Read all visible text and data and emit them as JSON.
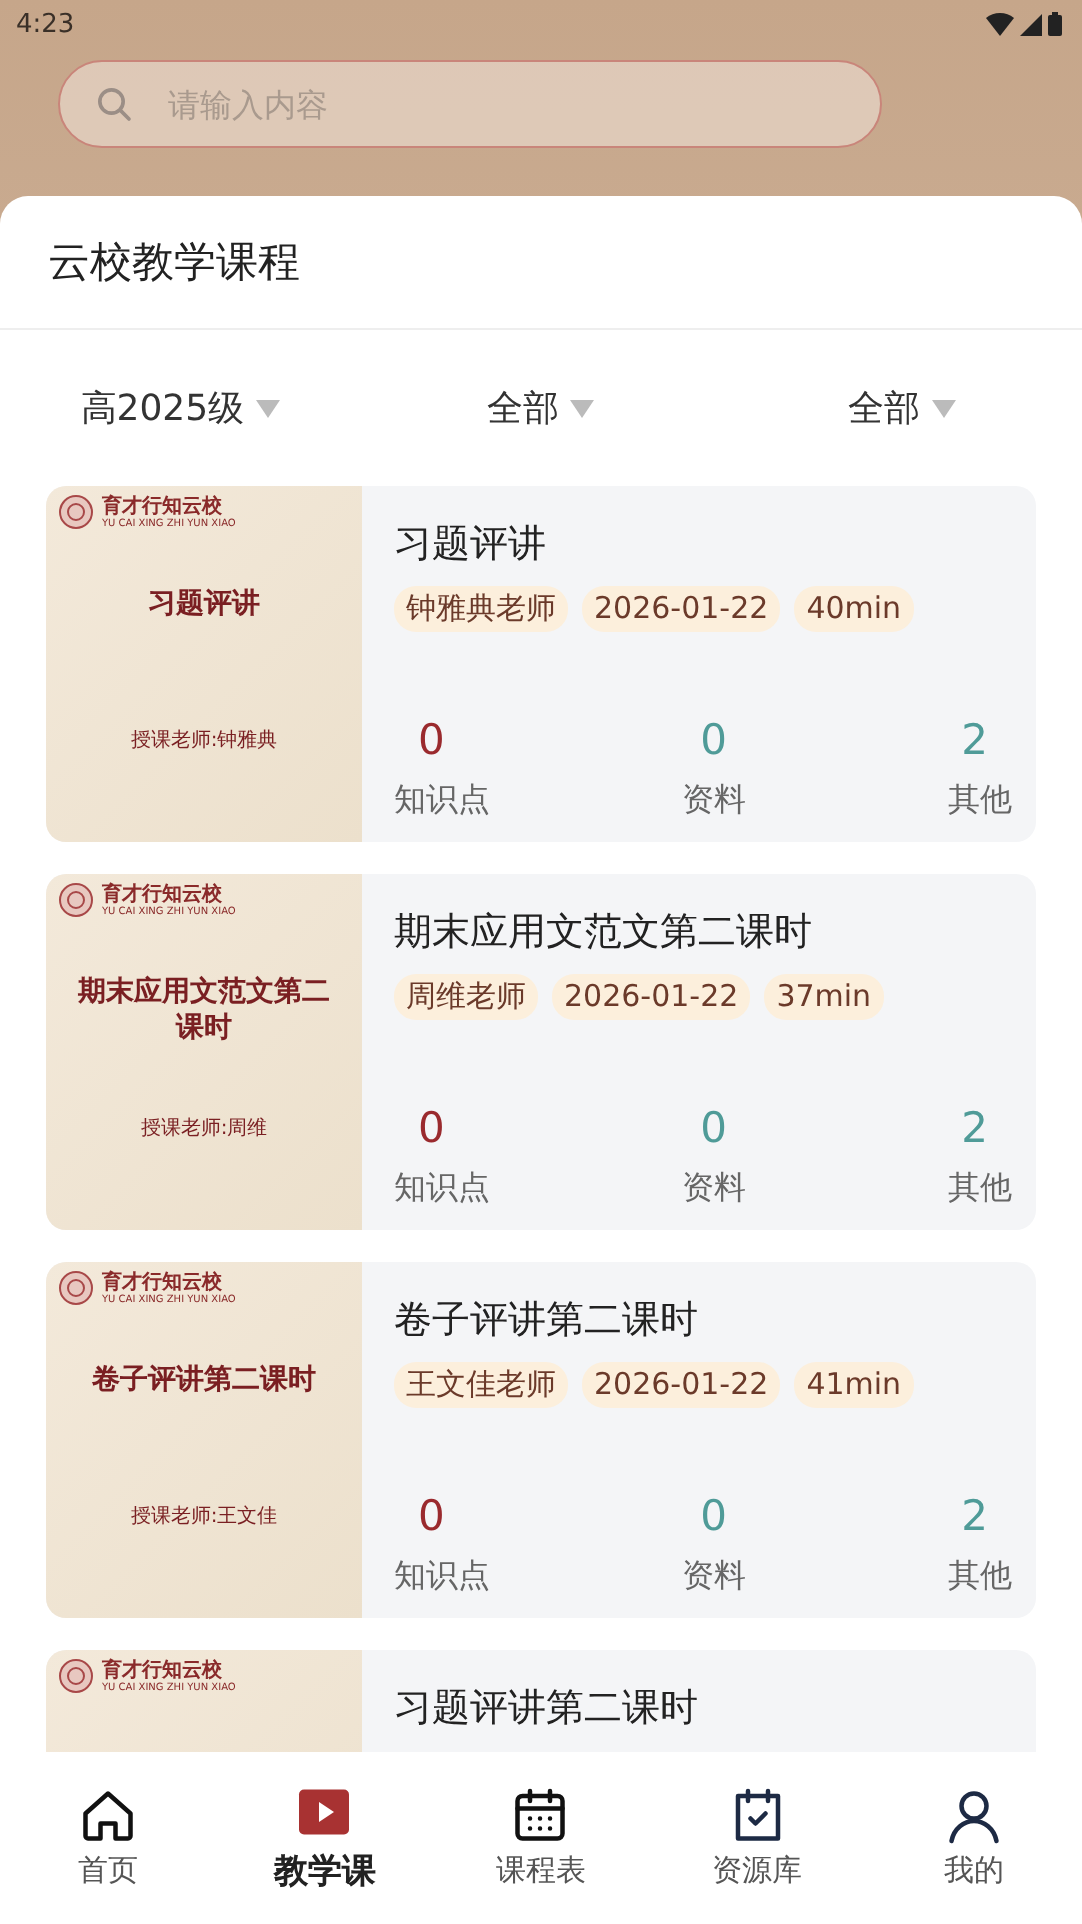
{
  "status_bar": {
    "time": "4:23"
  },
  "search": {
    "placeholder": "请输入内容"
  },
  "header": {
    "title": "云校教学课程"
  },
  "filters": [
    {
      "label": "高2025级"
    },
    {
      "label": "全部"
    },
    {
      "label": "全部"
    }
  ],
  "courses": [
    {
      "cover": {
        "school": "育才行知云校",
        "school_en": "YU CAI XING ZHI YUN XIAO",
        "title": "习题评讲",
        "teacher": "授课老师:钟雅典"
      },
      "title": "习题评讲",
      "tags": [
        "钟雅典老师",
        "2026-01-22",
        "40min"
      ],
      "stats": [
        {
          "value": "0",
          "label": "知识点",
          "kind": "knowledge"
        },
        {
          "value": "0",
          "label": "资料",
          "kind": "material"
        },
        {
          "value": "2",
          "label": "其他",
          "kind": "other"
        }
      ]
    },
    {
      "cover": {
        "school": "育才行知云校",
        "school_en": "YU CAI XING ZHI YUN XIAO",
        "title": "期末应用文范文第二课时",
        "teacher": "授课老师:周维"
      },
      "title": "期末应用文范文第二课时",
      "tags": [
        "周维老师",
        "2026-01-22",
        "37min"
      ],
      "stats": [
        {
          "value": "0",
          "label": "知识点",
          "kind": "knowledge"
        },
        {
          "value": "0",
          "label": "资料",
          "kind": "material"
        },
        {
          "value": "2",
          "label": "其他",
          "kind": "other"
        }
      ]
    },
    {
      "cover": {
        "school": "育才行知云校",
        "school_en": "YU CAI XING ZHI YUN XIAO",
        "title": "卷子评讲第二课时",
        "teacher": "授课老师:王文佳"
      },
      "title": "卷子评讲第二课时",
      "tags": [
        "王文佳老师",
        "2026-01-22",
        "41min"
      ],
      "stats": [
        {
          "value": "0",
          "label": "知识点",
          "kind": "knowledge"
        },
        {
          "value": "0",
          "label": "资料",
          "kind": "material"
        },
        {
          "value": "2",
          "label": "其他",
          "kind": "other"
        }
      ]
    },
    {
      "cover": {
        "school": "育才行知云校",
        "school_en": "YU CAI XING ZHI YUN XIAO"
      },
      "title": "习题评讲第二课时"
    }
  ],
  "nav": [
    {
      "label": "首页",
      "selected": false
    },
    {
      "label": "教学课",
      "selected": true
    },
    {
      "label": "课程表",
      "selected": false
    },
    {
      "label": "资源库",
      "selected": false
    },
    {
      "label": "我的",
      "selected": false
    }
  ]
}
